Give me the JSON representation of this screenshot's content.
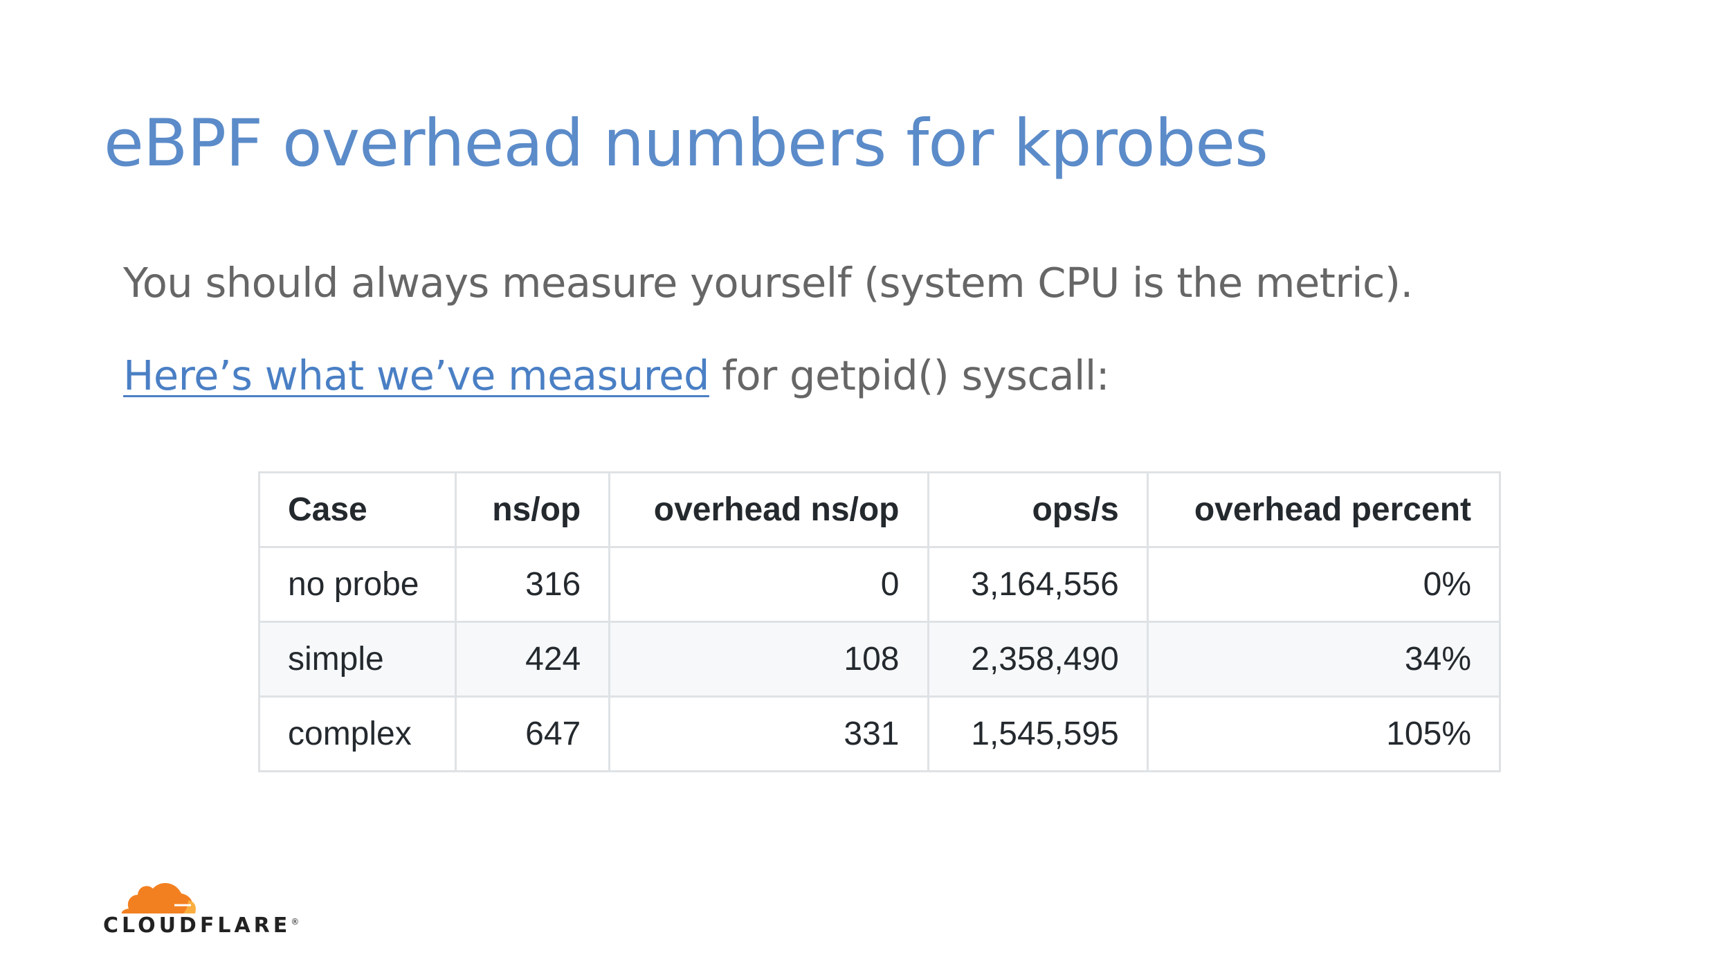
{
  "slide": {
    "title": "eBPF overhead numbers for kprobes",
    "line1": "You should always measure yourself (system CPU is the metric).",
    "line2_link": "Here’s what we’ve measured",
    "line2_rest": " for getpid() syscall:"
  },
  "table": {
    "headers": [
      "Case",
      "ns/op",
      "overhead ns/op",
      "ops/s",
      "overhead percent"
    ],
    "rows": [
      [
        "no probe",
        "316",
        "0",
        "3,164,556",
        "0%"
      ],
      [
        "simple",
        "424",
        "108",
        "2,358,490",
        "34%"
      ],
      [
        "complex",
        "647",
        "331",
        "1,545,595",
        "105%"
      ]
    ]
  },
  "logo": {
    "text": "CLOUDFLARE",
    "mark": "®",
    "icon": "cloudflare-cloud-icon",
    "colors": {
      "orange": "#f38020",
      "light_orange": "#faae40"
    }
  },
  "colors": {
    "title": "#5b8bc9",
    "body_text": "#666666",
    "link": "#4a7fc4",
    "table_border": "#dfe2e5",
    "table_alt_row": "#f6f8fa"
  }
}
